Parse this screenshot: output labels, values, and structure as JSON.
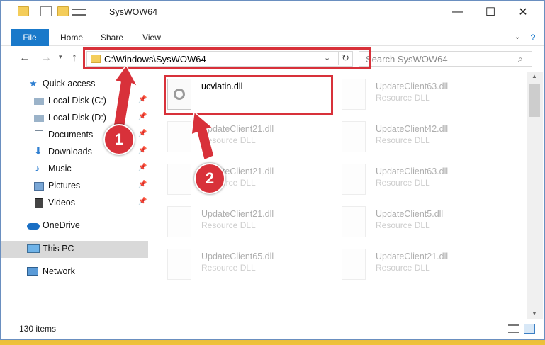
{
  "window": {
    "title": "SysWOW64"
  },
  "ribbon": {
    "tabs": [
      "File",
      "Home",
      "Share",
      "View"
    ]
  },
  "address": {
    "path": "C:\\Windows\\SysWOW64"
  },
  "search": {
    "placeholder": "Search SysWOW64"
  },
  "nav": {
    "quick_access": "Quick access",
    "items": [
      {
        "label": "Local Disk (C:)",
        "icon": "drive-icon"
      },
      {
        "label": "Local Disk (D:)",
        "icon": "drive-icon"
      },
      {
        "label": "Documents",
        "icon": "documents-icon"
      },
      {
        "label": "Downloads",
        "icon": "downloads-icon"
      },
      {
        "label": "Music",
        "icon": "music-icon"
      },
      {
        "label": "Pictures",
        "icon": "pictures-icon"
      },
      {
        "label": "Videos",
        "icon": "videos-icon"
      }
    ],
    "onedrive": "OneDrive",
    "thispc": "This PC",
    "network": "Network"
  },
  "files": [
    {
      "name": "ucvlatin.dll",
      "type": ""
    },
    {
      "name": "UpdateClient63.dll",
      "type": "Resource DLL"
    },
    {
      "name": "UpdateClient21.dll",
      "type": "Resource DLL"
    },
    {
      "name": "UpdateClient42.dll",
      "type": "Resource DLL"
    },
    {
      "name": "UpdateClient21.dll",
      "type": "Resource DLL"
    },
    {
      "name": "UpdateClient63.dll",
      "type": "Resource DLL"
    },
    {
      "name": "UpdateClient21.dll",
      "type": "Resource DLL"
    },
    {
      "name": "UpdateClient5.dll",
      "type": "Resource DLL"
    },
    {
      "name": "UpdateClient65.dll",
      "type": "Resource DLL"
    },
    {
      "name": "UpdateClient21.dll",
      "type": "Resource DLL"
    }
  ],
  "status": {
    "count": "130 items"
  },
  "callouts": [
    "1",
    "2"
  ],
  "colors": {
    "accent": "#1979ca",
    "highlight": "#d8313a"
  }
}
